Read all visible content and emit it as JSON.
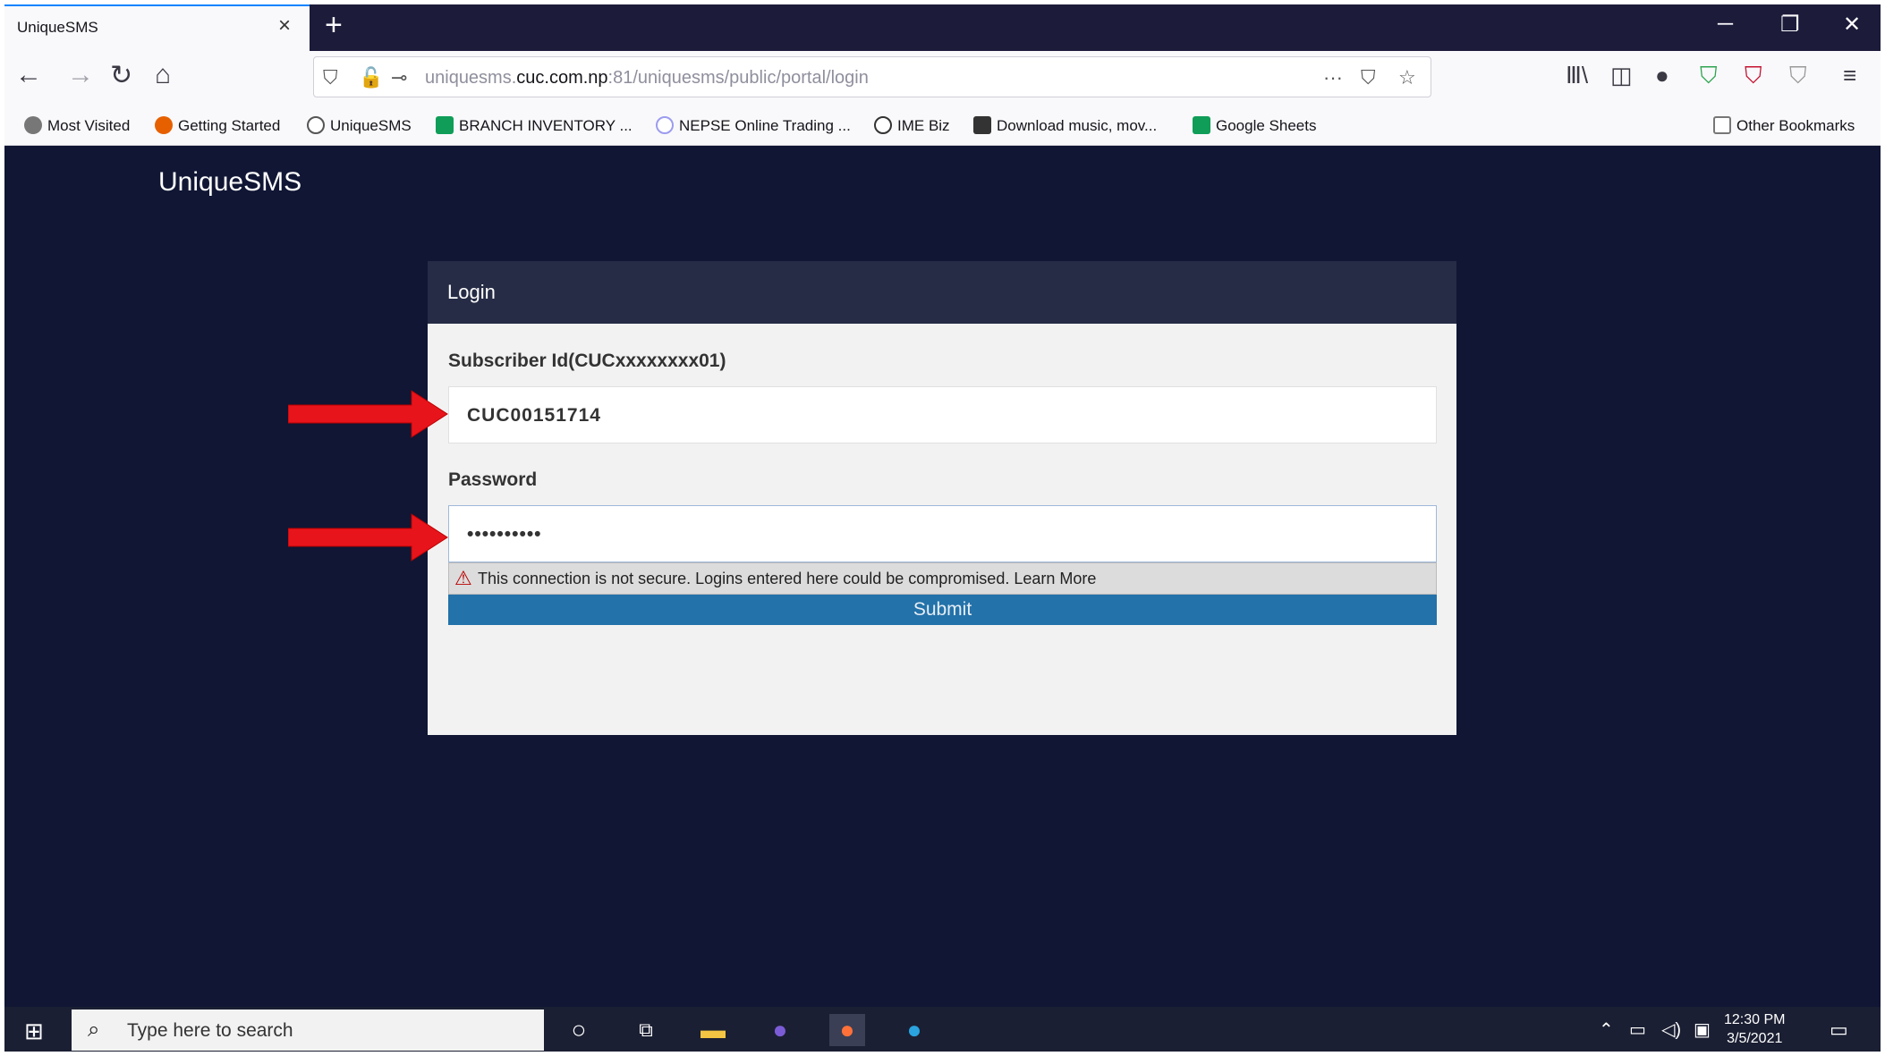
{
  "browser": {
    "tab_title": "UniqueSMS",
    "tab_close": "×",
    "new_tab": "+",
    "window_controls": {
      "minimize": "─",
      "maximize": "❐",
      "close": "✕"
    },
    "nav": {
      "back": "←",
      "forward": "→",
      "reload": "↻",
      "home": "⌂"
    },
    "url": {
      "prefix": "uniquesms.",
      "domain": "cuc.com.np",
      "path": ":81/uniquesms/public/portal/login"
    },
    "url_icons": {
      "shield": "⛉",
      "insecure_lock": "🔓",
      "permissions": "⊸",
      "more": "···",
      "pocket": "⛉",
      "star": "☆"
    },
    "toolbar_icons": [
      "Ⅲ\\",
      "◫",
      "●",
      "⛉",
      "⛉",
      "⛉",
      "≡"
    ],
    "bookmarks": [
      {
        "label": "Most Visited",
        "icon": "gear-icon",
        "color": "#555555"
      },
      {
        "label": "Getting Started",
        "icon": "firefox-icon",
        "color": "#e66000"
      },
      {
        "label": "UniqueSMS",
        "icon": "globe-icon",
        "color": "#555555"
      },
      {
        "label": "BRANCH INVENTORY ...",
        "icon": "sheets-icon",
        "color": "#0f9d58"
      },
      {
        "label": "NEPSE Online Trading ...",
        "icon": "globe-icon",
        "color": "#9c9cf0"
      },
      {
        "label": "IME Biz",
        "icon": "globe-icon",
        "color": "#333333"
      },
      {
        "label": "Download music, mov...",
        "icon": "download-icon",
        "color": "#333333"
      },
      {
        "label": "Google Sheets",
        "icon": "sheets-icon",
        "color": "#0f9d58"
      }
    ],
    "other_bookmarks": "Other Bookmarks"
  },
  "page": {
    "brand": "UniqueSMS",
    "login": {
      "title": "Login",
      "subscriber_label": "Subscriber Id(CUCxxxxxxxx01)",
      "subscriber_value": "CUC00151714",
      "password_label": "Password",
      "password_value": "••••••••••",
      "warning": "This connection is not secure. Logins entered here could be compromised. Learn More",
      "submit": "Submit"
    },
    "arrow_color": "#e8141b"
  },
  "taskbar": {
    "search_placeholder": "Type here to search",
    "time": "12:30 PM",
    "date": "3/5/2021"
  }
}
